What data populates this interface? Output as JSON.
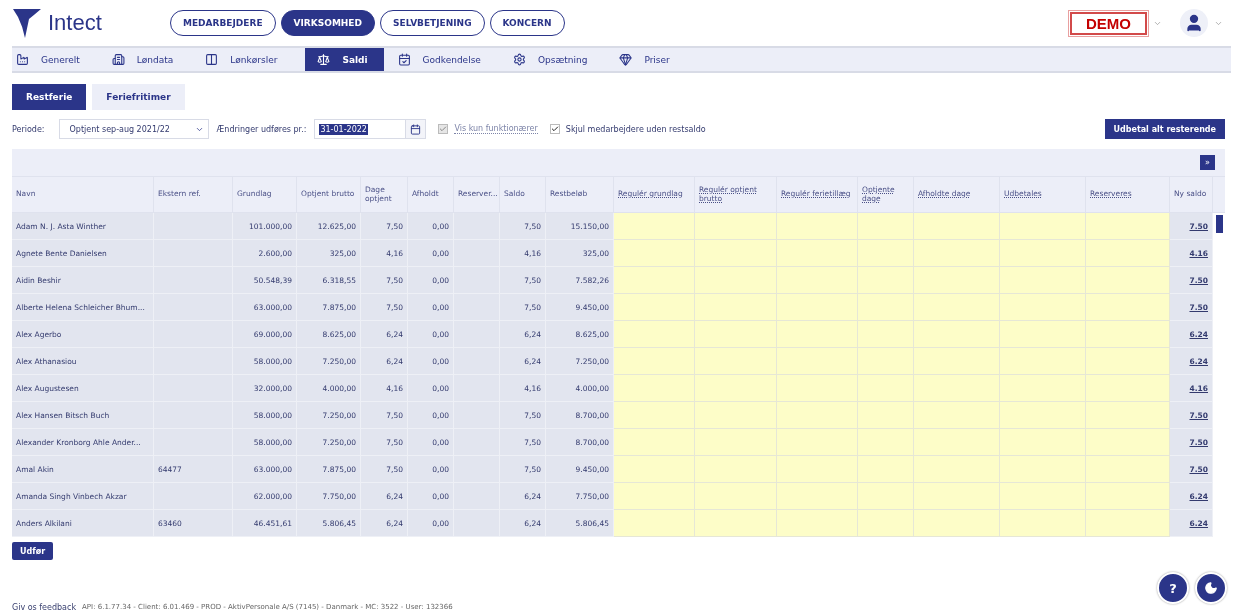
{
  "header": {
    "logo_text": "Intect",
    "main_nav": [
      {
        "label": "MEDARBEJDERE",
        "selected": false
      },
      {
        "label": "VIRKSOMHED",
        "selected": true
      },
      {
        "label": "SELVBETJENING",
        "selected": false
      },
      {
        "label": "KONCERN",
        "selected": false
      }
    ],
    "environment_badge": "DEMO"
  },
  "sub_nav": [
    {
      "label": "Generelt",
      "selected": false
    },
    {
      "label": "Løndata",
      "selected": false
    },
    {
      "label": "Lønkørsler",
      "selected": false
    },
    {
      "label": "Saldi",
      "selected": true
    },
    {
      "label": "Godkendelse",
      "selected": false
    },
    {
      "label": "Opsætning",
      "selected": false
    },
    {
      "label": "Priser",
      "selected": false
    }
  ],
  "tabs": [
    {
      "label": "Restferie",
      "selected": true
    },
    {
      "label": "Feriefritimer",
      "selected": false
    }
  ],
  "filters": {
    "period_label": "Periode:",
    "period_value": "Optjent sep-aug 2021/22",
    "date_label": "Ændringer udføres pr.:",
    "date_value": "31-01-2022",
    "checkboxes": [
      {
        "label": "Vis kun funktionærer",
        "checked": true,
        "disabled": true
      },
      {
        "label": "Skjul medarbejdere uden restsaldo",
        "checked": true,
        "disabled": false
      }
    ],
    "payout_button": "Udbetal alt resterende"
  },
  "table": {
    "expand_button": "»",
    "columns": [
      {
        "label": "Navn",
        "kind": "text"
      },
      {
        "label": "Ekstern ref.",
        "kind": "text"
      },
      {
        "label": "Grundlag",
        "kind": "text"
      },
      {
        "label": "Optjent brutto",
        "kind": "text"
      },
      {
        "label": "Dage optjent",
        "kind": "text"
      },
      {
        "label": "Afholdt",
        "kind": "text"
      },
      {
        "label": "Reserver...",
        "kind": "text"
      },
      {
        "label": "Saldo",
        "kind": "text"
      },
      {
        "label": "Restbeløb",
        "kind": "text"
      },
      {
        "label": "Regulér grundlag",
        "kind": "editable"
      },
      {
        "label": "Regulér optjent brutto",
        "kind": "editable"
      },
      {
        "label": "Regulér ferietillæg",
        "kind": "editable"
      },
      {
        "label": "Optjente dage",
        "kind": "editable"
      },
      {
        "label": "Afholdte dage",
        "kind": "editable"
      },
      {
        "label": "Udbetales",
        "kind": "editable"
      },
      {
        "label": "Reserveres",
        "kind": "editable"
      },
      {
        "label": "Ny saldo",
        "kind": "text"
      }
    ],
    "rows": [
      {
        "name": "Adam N. J. Asta Winther",
        "ext": "",
        "grundlag": "101.000,00",
        "optjent": "12.625,00",
        "dage": "7,50",
        "afholdt": "0,00",
        "saldo": "7,50",
        "rest": "15.150,00",
        "ny_saldo": "7.50"
      },
      {
        "name": "Agnete Bente Danielsen",
        "ext": "",
        "grundlag": "2.600,00",
        "optjent": "325,00",
        "dage": "4,16",
        "afholdt": "0,00",
        "saldo": "4,16",
        "rest": "325,00",
        "ny_saldo": "4.16"
      },
      {
        "name": "Aidin Beshir",
        "ext": "",
        "grundlag": "50.548,39",
        "optjent": "6.318,55",
        "dage": "7,50",
        "afholdt": "0,00",
        "saldo": "7,50",
        "rest": "7.582,26",
        "ny_saldo": "7.50"
      },
      {
        "name": "Alberte Helena Schleicher Bhum...",
        "ext": "",
        "grundlag": "63.000,00",
        "optjent": "7.875,00",
        "dage": "7,50",
        "afholdt": "0,00",
        "saldo": "7,50",
        "rest": "9.450,00",
        "ny_saldo": "7.50"
      },
      {
        "name": "Alex Agerbo",
        "ext": "",
        "grundlag": "69.000,00",
        "optjent": "8.625,00",
        "dage": "6,24",
        "afholdt": "0,00",
        "saldo": "6,24",
        "rest": "8.625,00",
        "ny_saldo": "6.24"
      },
      {
        "name": "Alex Athanasiou",
        "ext": "",
        "grundlag": "58.000,00",
        "optjent": "7.250,00",
        "dage": "6,24",
        "afholdt": "0,00",
        "saldo": "6,24",
        "rest": "7.250,00",
        "ny_saldo": "6.24"
      },
      {
        "name": "Alex Augustesen",
        "ext": "",
        "grundlag": "32.000,00",
        "optjent": "4.000,00",
        "dage": "4,16",
        "afholdt": "0,00",
        "saldo": "4,16",
        "rest": "4.000,00",
        "ny_saldo": "4.16"
      },
      {
        "name": "Alex Hansen Bitsch Buch",
        "ext": "",
        "grundlag": "58.000,00",
        "optjent": "7.250,00",
        "dage": "7,50",
        "afholdt": "0,00",
        "saldo": "7,50",
        "rest": "8.700,00",
        "ny_saldo": "7.50"
      },
      {
        "name": "Alexander Kronborg Ahle Ander...",
        "ext": "",
        "grundlag": "58.000,00",
        "optjent": "7.250,00",
        "dage": "7,50",
        "afholdt": "0,00",
        "saldo": "7,50",
        "rest": "8.700,00",
        "ny_saldo": "7.50"
      },
      {
        "name": "Amal Akin",
        "ext": "64477",
        "grundlag": "63.000,00",
        "optjent": "7.875,00",
        "dage": "7,50",
        "afholdt": "0,00",
        "saldo": "7,50",
        "rest": "9.450,00",
        "ny_saldo": "7.50"
      },
      {
        "name": "Amanda Singh Vinbech Akzar",
        "ext": "",
        "grundlag": "62.000,00",
        "optjent": "7.750,00",
        "dage": "6,24",
        "afholdt": "0,00",
        "saldo": "6,24",
        "rest": "7.750,00",
        "ny_saldo": "6.24"
      },
      {
        "name": "Anders Alkilani",
        "ext": "63460",
        "grundlag": "46.451,61",
        "optjent": "5.806,45",
        "dage": "6,24",
        "afholdt": "0,00",
        "saldo": "6,24",
        "rest": "5.806,45",
        "ny_saldo": "6.24"
      }
    ]
  },
  "execute_button": "Udfør",
  "footer": {
    "feedback_link": "Giv os feedback",
    "version_info": "API: 6.1.77.34 - Client: 6.01.469 - PROD - AktivPersonale A/S (7145) - Danmark - MC: 3522 - User: 132366",
    "help_button": "?"
  }
}
